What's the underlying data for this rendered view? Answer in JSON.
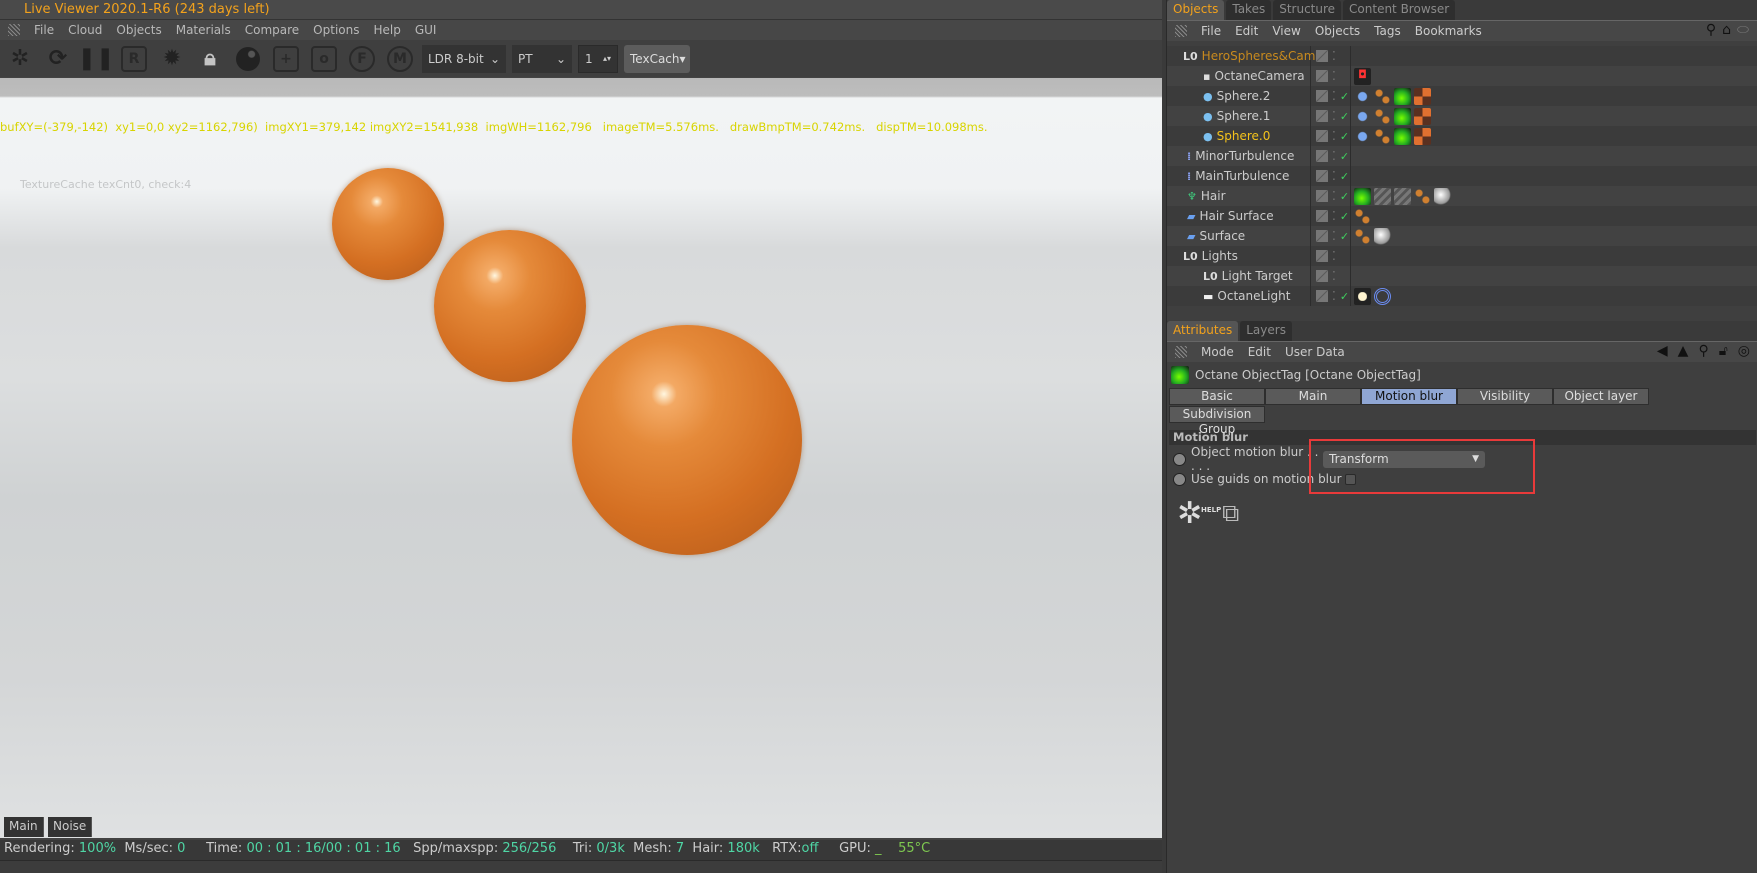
{
  "viewer": {
    "title": "Live Viewer 2020.1-R6 (243 days left)",
    "menu": [
      "File",
      "Cloud",
      "Objects",
      "Materials",
      "Compare",
      "Options",
      "Help",
      "GUI"
    ],
    "toolbar": {
      "icons": [
        "octane-logo-icon",
        "refresh-icon",
        "pause-icon",
        "region-render-icon",
        "settings-gear-icon",
        "lock-icon",
        "material-ball-icon",
        "add-box-icon",
        "clear-box-icon",
        "focus-pin-icon",
        "material-pin-icon"
      ],
      "region_label": "R",
      "focus_label": "F",
      "material_label": "M",
      "color_mode": "LDR 8-bit",
      "kernel": "PT",
      "layer": "1",
      "texcache": "TexCach"
    },
    "debug_text": "bufXY=(-379,-142)  xy1=0,0 xy2=1162,796)  imgXY1=379,142 imgXY2=1541,938  imgWH=1162,796   imageTM=5.576ms.   drawBmpTM=0.742ms.   dispTM=10.098ms.",
    "texture_cache": "TextureCache texCnt0, check:4",
    "view_tabs": [
      "Main",
      "Noise"
    ],
    "status": {
      "rendering_label": "Rendering:",
      "rendering": "100%",
      "ms_label": "Ms/sec:",
      "ms": "0",
      "time_label": "Time:",
      "time": "00 : 01 : 16/00 : 01 : 16",
      "spp_label": "Spp/maxspp:",
      "spp": "256/256",
      "tri_label": "Tri:",
      "tri": "0/3k",
      "mesh_label": "Mesh:",
      "mesh": "7",
      "hair_label": "Hair:",
      "hair": "180k",
      "rtx_label": "RTX:",
      "rtx": "off",
      "gpu_label": "GPU:",
      "gpu": "_",
      "temp": "55°C"
    }
  },
  "objects": {
    "tabs": [
      "Objects",
      "Takes",
      "Structure",
      "Content Browser"
    ],
    "menu": [
      "File",
      "Edit",
      "View",
      "Objects",
      "Tags",
      "Bookmarks"
    ],
    "tree": [
      {
        "name": "HeroSpheres&Cam",
        "type": "null",
        "color": "#c88a1e",
        "check": false,
        "tags": []
      },
      {
        "name": "OctaneCamera",
        "type": "camera",
        "check": false,
        "tags": [
          "c"
        ]
      },
      {
        "name": "Sphere.2",
        "type": "sphere",
        "check": true,
        "tags": [
          "s",
          "p",
          "g",
          "m"
        ]
      },
      {
        "name": "Sphere.1",
        "type": "sphere",
        "check": true,
        "tags": [
          "s",
          "p",
          "g",
          "m"
        ]
      },
      {
        "name": "Sphere.0",
        "type": "sphere",
        "color": "#f3c21c",
        "check": true,
        "tags": [
          "s",
          "p",
          "g",
          "m"
        ]
      },
      {
        "name": "MinorTurbulence",
        "type": "turbulence",
        "check": true,
        "tags": []
      },
      {
        "name": "MainTurbulence",
        "type": "turbulence",
        "check": true,
        "tags": []
      },
      {
        "name": "Hair",
        "type": "hair",
        "check": true,
        "tags": [
          "g",
          "h",
          "h",
          "p",
          "w"
        ]
      },
      {
        "name": "Hair Surface",
        "type": "plane",
        "check": true,
        "tags": [
          "p"
        ]
      },
      {
        "name": "Surface",
        "type": "plane",
        "check": true,
        "tags": [
          "p",
          "w"
        ]
      },
      {
        "name": "Lights",
        "type": "null",
        "check": false,
        "tags": []
      },
      {
        "name": "Light Target",
        "type": "null",
        "check": false,
        "tags": []
      },
      {
        "name": "OctaneLight",
        "type": "light",
        "check": true,
        "tags": [
          "l",
          "t"
        ]
      }
    ]
  },
  "attributes": {
    "tabs": [
      "Attributes",
      "Layers"
    ],
    "menu": [
      "Mode",
      "Edit",
      "User Data"
    ],
    "object_title": "Octane ObjectTag [Octane ObjectTag]",
    "tag_tabs": [
      "Basic",
      "Main",
      "Motion blur",
      "Visibility",
      "Object layer",
      "Subdivision Group"
    ],
    "active_tab": "Motion blur",
    "section": "Motion blur",
    "object_motion_blur_label": "Object motion blur . . . . .",
    "object_motion_blur_value": "Transform",
    "use_guids_label": "Use guids on motion blur",
    "use_guids_checked": false,
    "help_label": "HELP",
    "highlight_color": "#e83a3a"
  }
}
